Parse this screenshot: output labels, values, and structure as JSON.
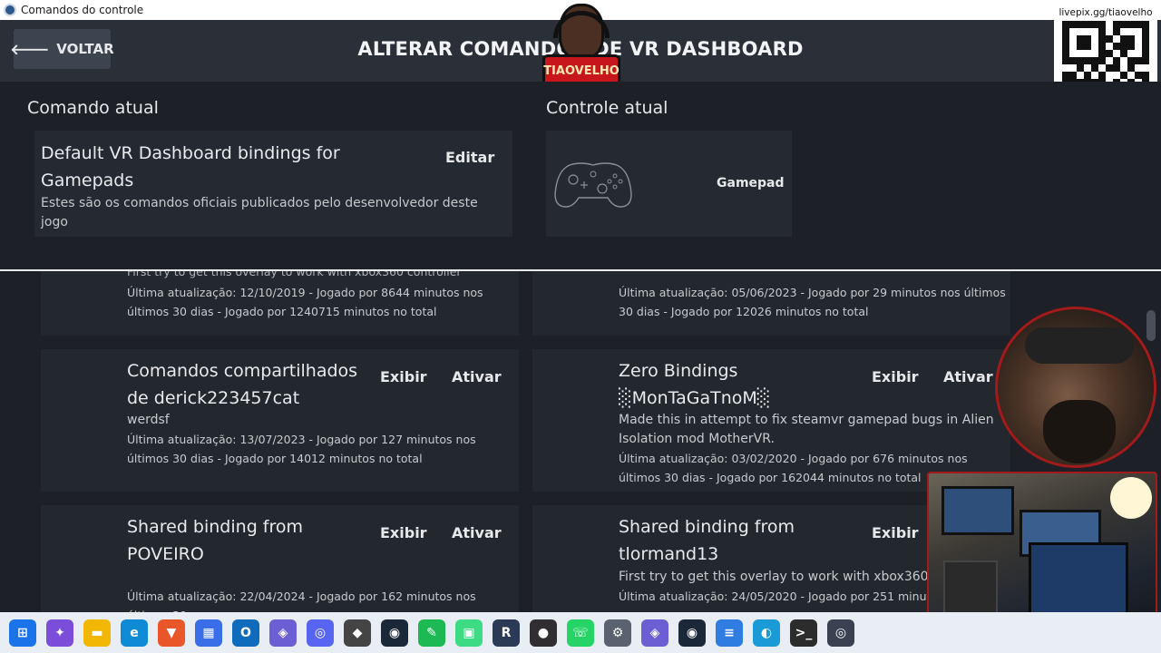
{
  "window": {
    "title": "Comandos do controle"
  },
  "header": {
    "back_label": "VOLTAR",
    "page_title": "ALTERAR COMANDOS DE VR DASHBOARD"
  },
  "overlay": {
    "logo_text": "TIAOVELHO",
    "qr_label": "livepix.gg/tiaovelho"
  },
  "current": {
    "command_heading": "Comando atual",
    "controller_heading": "Controle atual",
    "binding_name": "Default VR Dashboard bindings for Gamepads",
    "binding_desc": "Estes são os comandos oficiais publicados pelo desenvolvedor deste jogo",
    "edit_label": "Editar",
    "controller_label": "Gamepad"
  },
  "list": {
    "partial_top_left": {
      "snippet": "First try to get this overlay to work with xbox360 controller",
      "meta": "Última atualização: 12/10/2019 - Jogado por 8644 minutos nos últimos 30 dias - Jogado por 1240715 minutos no total"
    },
    "partial_top_right": {
      "meta": "Última atualização: 05/06/2023 - Jogado por 29 minutos nos últimos 30 dias - Jogado por 12026 minutos no total"
    },
    "items": [
      {
        "title": "Comandos compartilhados de derick223457cat",
        "author": "werdsf",
        "meta": "Última atualização: 13/07/2023 - Jogado por 127 minutos nos últimos 30 dias - Jogado por 14012 minutos no total",
        "view_label": "Exibir",
        "activate_label": "Ativar"
      },
      {
        "title": "Zero Bindings ░MonTaGaTnoM░",
        "author": "Made this in attempt to fix steamvr gamepad bugs in Alien Isolation mod MotherVR.",
        "meta": "Última atualização: 03/02/2020 - Jogado por 676 minutos nos últimos 30 dias - Jogado por 162044 minutos no total",
        "view_label": "Exibir",
        "activate_label": "Ativar"
      },
      {
        "title": "Shared binding from POVEIRO",
        "meta": "Última atualização: 22/04/2024 - Jogado por 162 minutos nos últimos 30",
        "view_label": "Exibir",
        "activate_label": "Ativar"
      },
      {
        "title": "Shared binding from tlormand13",
        "author": "First try to get this overlay to work with xbox360",
        "meta": "Última atualização: 24/05/2020 - Jogado por 251 minutos n",
        "view_label": "Exibir"
      }
    ]
  },
  "taskbar": {
    "apps": [
      {
        "name": "start-icon",
        "color": "#1a73e8",
        "glyph": "⊞"
      },
      {
        "name": "copilot-icon",
        "color": "#7b4dd8",
        "glyph": "✦"
      },
      {
        "name": "file-explorer-icon",
        "color": "#f2b705",
        "glyph": "▬"
      },
      {
        "name": "edge-icon",
        "color": "#0f8bd6",
        "glyph": "e"
      },
      {
        "name": "brave-icon",
        "color": "#e8562a",
        "glyph": "▼"
      },
      {
        "name": "store-icon",
        "color": "#3a6ee8",
        "glyph": "▦"
      },
      {
        "name": "outlook-icon",
        "color": "#0f6cbd",
        "glyph": "O"
      },
      {
        "name": "vr-app-icon",
        "color": "#6b5fd3",
        "glyph": "◈"
      },
      {
        "name": "discord-icon",
        "color": "#5865f2",
        "glyph": "◎"
      },
      {
        "name": "unity-icon",
        "color": "#444444",
        "glyph": "◆"
      },
      {
        "name": "steam-icon",
        "color": "#1b2838",
        "glyph": "◉"
      },
      {
        "name": "pen-app-icon",
        "color": "#1db954",
        "glyph": "✎"
      },
      {
        "name": "android-icon",
        "color": "#3ddc84",
        "glyph": "▣"
      },
      {
        "name": "r-app-icon",
        "color": "#2b3a55",
        "glyph": "R"
      },
      {
        "name": "obs-icon",
        "color": "#302e31",
        "glyph": "●"
      },
      {
        "name": "whatsapp-icon",
        "color": "#25d366",
        "glyph": "☏"
      },
      {
        "name": "settings-icon",
        "color": "#5a6270",
        "glyph": "⚙"
      },
      {
        "name": "vr-app-2-icon",
        "color": "#6b5fd3",
        "glyph": "◈"
      },
      {
        "name": "steam-2-icon",
        "color": "#1b2838",
        "glyph": "◉"
      },
      {
        "name": "notepad-icon",
        "color": "#2f7de0",
        "glyph": "≡"
      },
      {
        "name": "browser-icon",
        "color": "#1a9bd7",
        "glyph": "◐"
      },
      {
        "name": "terminal-icon",
        "color": "#2c2c2c",
        "glyph": ">_"
      },
      {
        "name": "steamvr-icon",
        "color": "#3b4150",
        "glyph": "◎"
      }
    ]
  }
}
